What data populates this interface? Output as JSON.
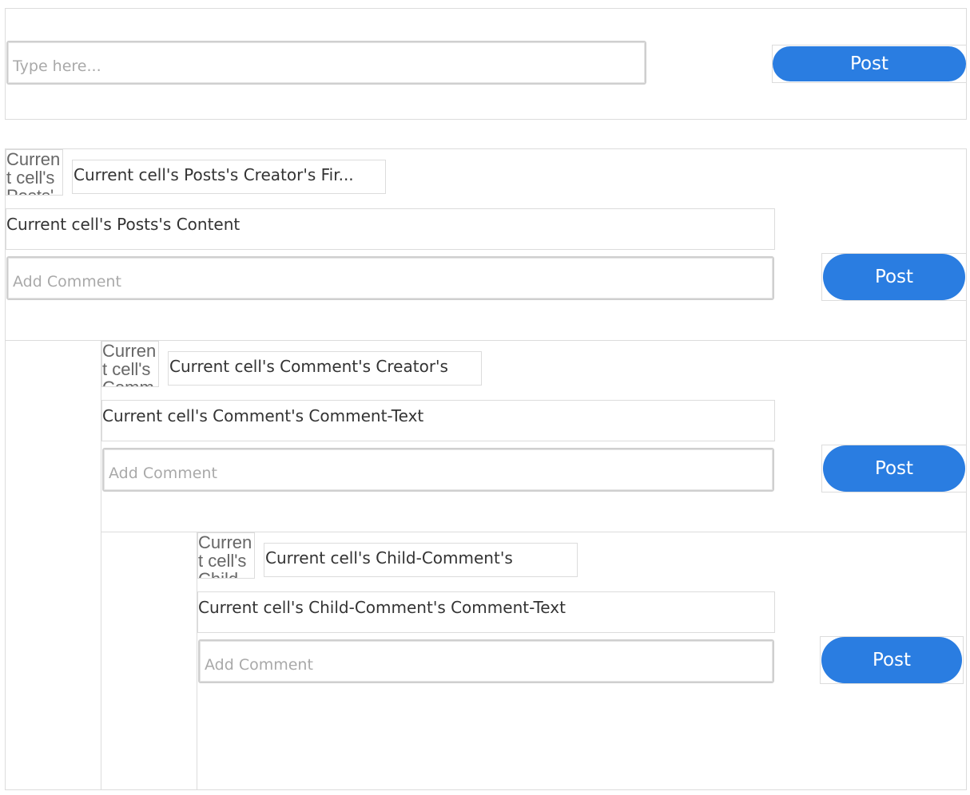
{
  "new_post": {
    "placeholder": "Type here...",
    "post_label": "Post"
  },
  "post": {
    "avatar_alt": "Current cell's Posts's",
    "creator_name": "Current cell's Posts's Creator's Fir...",
    "content": "Current cell's Posts's Content",
    "comment_placeholder": "Add Comment",
    "post_label": "Post"
  },
  "comment": {
    "avatar_alt": "Current cell's Comm",
    "creator_name": "Current cell's Comment's Creator's",
    "text": "Current cell's Comment's Comment-Text",
    "comment_placeholder": "Add Comment",
    "post_label": "Post"
  },
  "child_comment": {
    "avatar_alt": "Current cell's Child",
    "creator_name": "Current cell's Child-Comment's",
    "text": "Current cell's Child-Comment's Comment-Text",
    "comment_placeholder": "Add Comment",
    "post_label": "Post"
  },
  "colors": {
    "accent": "#2a7de1",
    "border": "#dcdcdc",
    "placeholder": "#a9a9a9"
  }
}
